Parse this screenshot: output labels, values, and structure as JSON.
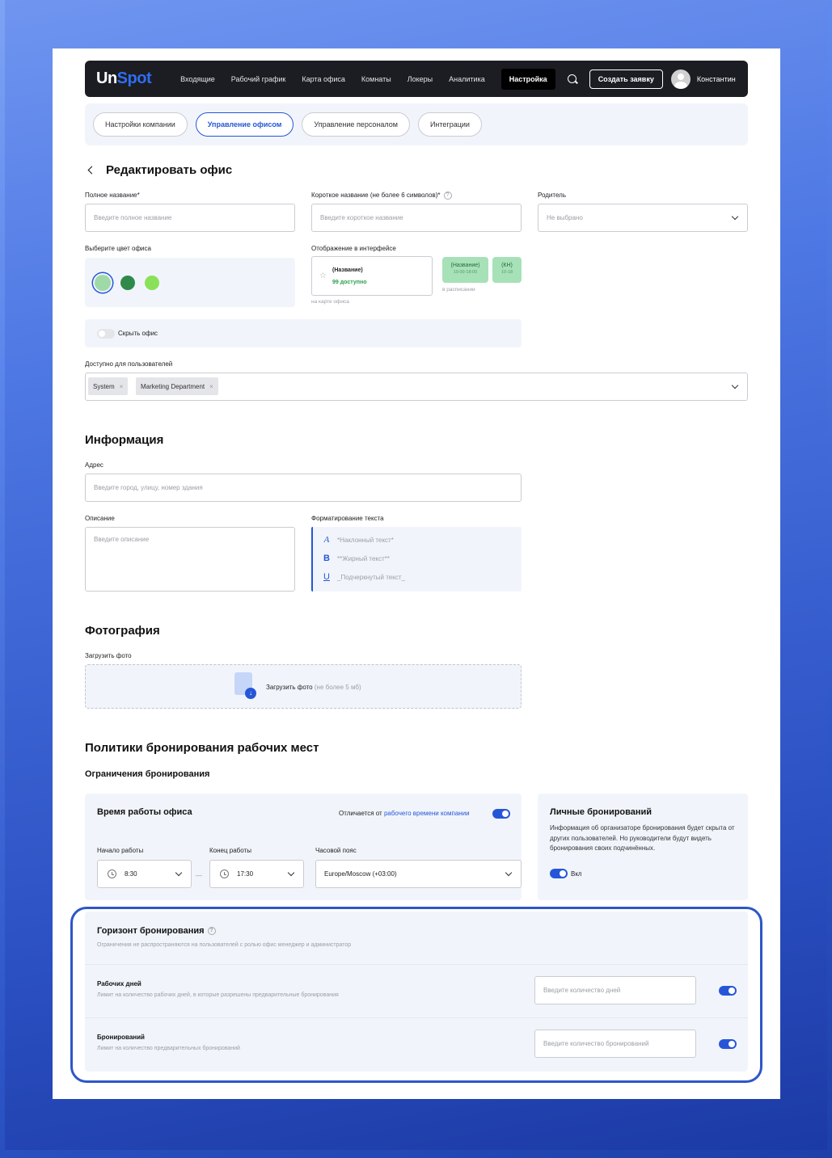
{
  "nav": {
    "logo_a": "Un",
    "logo_b": "Spot",
    "items": [
      "Входящие",
      "Рабочий график",
      "Карта офиса",
      "Комнаты",
      "Локеры",
      "Аналитика"
    ],
    "active_item": "Настройка",
    "create_button": "Создать заявку",
    "user_name": "Константин"
  },
  "tabs": [
    {
      "label": "Настройки компании",
      "active": false
    },
    {
      "label": "Управление офисом",
      "active": true
    },
    {
      "label": "Управление персоналом",
      "active": false
    },
    {
      "label": "Интеграции",
      "active": false
    }
  ],
  "edit": {
    "title": "Редактировать офис",
    "full_name_label": "Полное название*",
    "full_name_placeholder": "Введите полное название",
    "short_name_label": "Короткое название (не более 6 символов)*",
    "short_name_placeholder": "Введите короткое название",
    "parent_label": "Родитель",
    "parent_value": "Не выбрано",
    "color_label": "Выберите цвет офиса",
    "colors": [
      "#9fd9a8",
      "#2f8a4a",
      "#8be05a"
    ],
    "display_label": "Отображение в интерфейсе",
    "preview_name": "(Название)",
    "preview_available": "99 доступно",
    "preview_map_caption": "на карте офиса",
    "badge_name": "(Название)",
    "badge_time": "10:00-18:00",
    "badge_short": "(КН)",
    "badge_short_time": "10-18",
    "schedule_caption": "в расписании",
    "hide_office_label": "Скрыть офис",
    "available_label": "Доступно для пользователей",
    "chips": [
      "System",
      "Marketing Department"
    ]
  },
  "info": {
    "title": "Информация",
    "address_label": "Адрес",
    "address_placeholder": "Введите город, улицу, номер здания",
    "description_label": "Описание",
    "description_placeholder": "Введите описание",
    "format_label": "Форматирование текста",
    "format_rows": [
      {
        "icon": "A",
        "text": "*Наклонный текст*"
      },
      {
        "icon": "B",
        "text": "**Жирный текст**"
      },
      {
        "icon": "U",
        "text": "_Подчеркнутый текст_"
      }
    ]
  },
  "photo": {
    "title": "Фотография",
    "upload_label": "Загрузить фото",
    "upload_action": "Загрузить фото",
    "upload_limit": "(не более 5 мб)"
  },
  "policy": {
    "title": "Политики бронирования рабочих мест",
    "subtitle": "Ограничения бронирования",
    "hours_title": "Время работы офиса",
    "differs_prefix": "Отличается от",
    "differs_link": "рабочего времени компании",
    "start_label": "Начало работы",
    "start_value": "8:30",
    "end_label": "Конец работы",
    "end_value": "17:30",
    "dash": "—",
    "tz_label": "Часовой пояс",
    "tz_value": "Europe/Moscow (+03:00)",
    "personal_title": "Личные бронирований",
    "personal_desc": "Информация об организаторе бронирования будет скрыта от других пользователей. Но руководители будут видеть бронирования своих подчинённых.",
    "personal_toggle_label": "Вкл",
    "horizon_title": "Горизонт бронирования",
    "horizon_desc": "Ограничения не распространяются на пользователей с ролью офис менеджер и администратор",
    "workdays_title": "Рабочих дней",
    "workdays_desc": "Лимит на количество рабочих дней, в которые разрешены предварительные бронирования",
    "workdays_placeholder": "Введите количество дней",
    "bookings_title": "Бронирований",
    "bookings_desc": "Лимит на количество предварительных бронирований",
    "bookings_placeholder": "Введите количество бронирований"
  }
}
